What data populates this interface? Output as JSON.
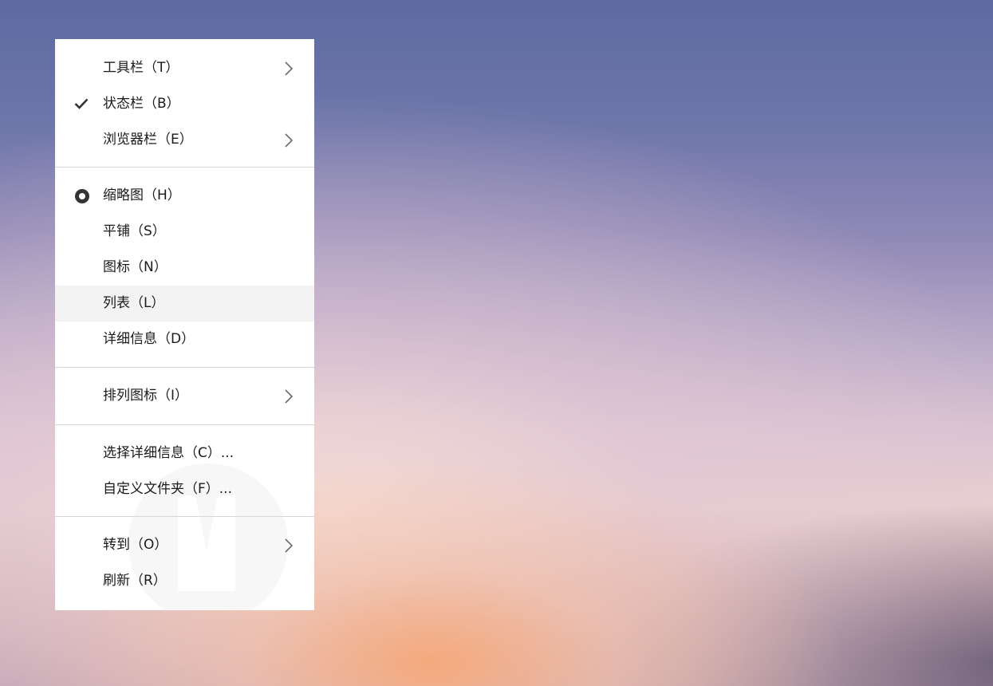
{
  "menu": {
    "toolbars": "工具栏（T）",
    "status_bar": "状态栏（B）",
    "explorer_bar": "浏览器栏（E）",
    "thumbnails": "缩略图（H）",
    "tiles": "平铺（S）",
    "icons": "图标（N）",
    "list": "列表（L）",
    "details": "详细信息（D）",
    "arrange_icons": "排列图标（I）",
    "choose_details": "选择详细信息（C）...",
    "customize_folder": "自定义文件夹（F）...",
    "go_to": "转到（O）",
    "refresh": "刷新（R）"
  },
  "state": {
    "checked_item": "status_bar",
    "selected_view": "thumbnails",
    "hovered_item": "list"
  },
  "icons": {
    "check": "checkmark-icon",
    "radio": "radio-selected-icon",
    "submenu": "chevron-right-icon"
  },
  "colors": {
    "menu_background": "#ffffff",
    "hover_background": "#f3f3f3",
    "separator": "#d7d7d7",
    "text": "#1b1b1b"
  }
}
